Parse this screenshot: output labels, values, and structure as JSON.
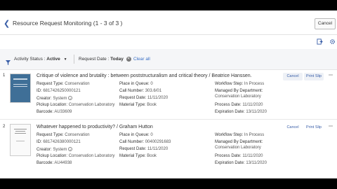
{
  "header": {
    "back_icon": "chevron-left-icon",
    "title": "Resource Request Monitoring (1 - 3 of 3 )",
    "cancel_label": "Cancel"
  },
  "toolbar": {
    "export_icon": "export-icon",
    "settings_icon": "gear-icon"
  },
  "filters": {
    "filter_icon": "funnel-icon",
    "activity_label": "Activity Status :",
    "activity_value": "Active",
    "request_date_label": "Request Date :",
    "request_date_value": "Today",
    "clear_all": "Clear all"
  },
  "colors": {
    "accent": "#3a5fa8",
    "link": "#3a6fc4",
    "filter_bg": "#f5f6f8"
  },
  "rows": [
    {
      "index": "1",
      "title": "Critique of violence and brutality : between poststructuralism and critical theory / Beatrice Hanssen.",
      "request_type_label": "Request Type:",
      "request_type": "Conservation",
      "id_label": "ID:",
      "id": "6817426250000121",
      "creator_label": "Creator:",
      "creator": "System",
      "pickup_label": "Pickup Location:",
      "pickup": "Conservation Laboratory",
      "barcode_label": "Barcode:",
      "barcode": "AU33609",
      "place_label": "Place in Queue:",
      "place": "0",
      "call_label": "Call Number:",
      "call": "303.6/01",
      "reqdate_label": "Request Date:",
      "reqdate": "11/11/2020",
      "material_label": "Material Type:",
      "material": "Book",
      "workflow_label": "Workflow Step:",
      "workflow": "In Process",
      "managed_label": "Managed By Department:",
      "managed": "Conservation Laboratory",
      "process_label": "Process Date:",
      "process": "11/11/2020",
      "expiration_label": "Expiration Date:",
      "expiration": "13/11/2020",
      "cancel": "Cancel",
      "print": "Print Slip"
    },
    {
      "index": "2",
      "title": "Whatever happened to productivity? / Graham Hutton",
      "request_type_label": "Request Type:",
      "request_type": "Conservation",
      "id_label": "ID:",
      "id": "6817426380000121",
      "creator_label": "Creator:",
      "creator": "System",
      "pickup_label": "Pickup Location:",
      "pickup": "Conservation Laboratory",
      "barcode_label": "Barcode:",
      "barcode": "AU44938",
      "place_label": "Place in Queue:",
      "place": "0",
      "call_label": "Call Number:",
      "call": "00400291683",
      "reqdate_label": "Request Date:",
      "reqdate": "11/11/2020",
      "material_label": "Material Type:",
      "material": "Book",
      "workflow_label": "Workflow Step:",
      "workflow": "In Process",
      "managed_label": "Managed By Department:",
      "managed": "Conservation Laboratory",
      "process_label": "Process Date:",
      "process": "11/11/2020",
      "expiration_label": "Expiration Date:",
      "expiration": "13/11/2020",
      "cancel": "Cancel",
      "print": "Print Slip"
    }
  ]
}
